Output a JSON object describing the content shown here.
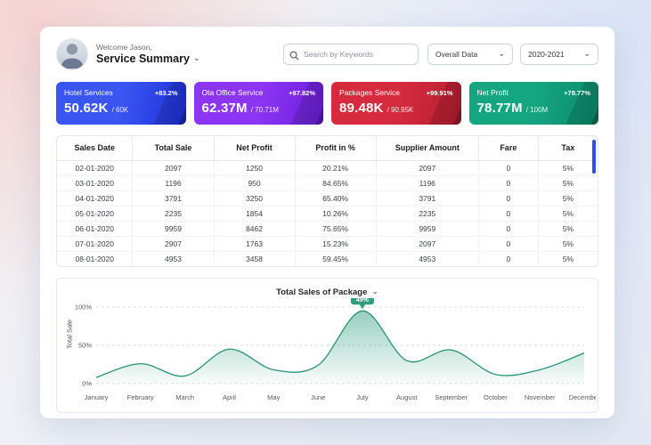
{
  "header": {
    "welcome": "Welcome Jason,",
    "title": "Service Summary",
    "search_placeholder": "Search by Keywords",
    "data_filter_value": "Overall Data",
    "year_filter_value": "2020-2021"
  },
  "stat_cards": [
    {
      "label": "Hotel Services",
      "badge": "+83.2%",
      "value": "50.62K",
      "target": "/ 60K",
      "color_from": "#3a55f2",
      "color_to": "#1d2fd6"
    },
    {
      "label": "Ota Office Service",
      "badge": "+87.82%",
      "value": "62.37M",
      "target": "/ 70.71M",
      "color_from": "#8d35f5",
      "color_to": "#6a1ed8"
    },
    {
      "label": "Packages Service",
      "badge": "+99.91%",
      "value": "89.48K",
      "target": "/ 90.95K",
      "color_from": "#d62a3e",
      "color_to": "#b51e31"
    },
    {
      "label": "Net Profit",
      "badge": "+78.77%",
      "value": "78.77M",
      "target": "/ 100M",
      "color_from": "#14a581",
      "color_to": "#0b8a6a"
    }
  ],
  "table": {
    "columns": [
      "Sales Date",
      "Total Sale",
      "Net Profit",
      "Profit in %",
      "Supplier Amount",
      "Fare",
      "Tax"
    ],
    "rows": [
      [
        "02-01-2020",
        "2097",
        "1250",
        "20.21%",
        "2097",
        "0",
        "5%"
      ],
      [
        "03-01-2020",
        "1196",
        "950",
        "84.65%",
        "1196",
        "0",
        "5%"
      ],
      [
        "04-01-2020",
        "3791",
        "3250",
        "65.40%",
        "3791",
        "0",
        "5%"
      ],
      [
        "05-01-2020",
        "2235",
        "1854",
        "10.26%",
        "2235",
        "0",
        "5%"
      ],
      [
        "06-01-2020",
        "9959",
        "8462",
        "75.65%",
        "9959",
        "0",
        "5%"
      ],
      [
        "07-01-2020",
        "2907",
        "1763",
        "15.23%",
        "2097",
        "0",
        "5%"
      ],
      [
        "08-01-2020",
        "4953",
        "3458",
        "59.45%",
        "4953",
        "0",
        "5%"
      ]
    ]
  },
  "chart_data": {
    "type": "area",
    "title": "Total Sales of Package",
    "ylabel": "Total Sale",
    "yticks": [
      "100%",
      "50%",
      "0%"
    ],
    "ylim": [
      0,
      100
    ],
    "grid": "dashed horizontal",
    "legend": "none",
    "categories": [
      "January",
      "February",
      "March",
      "April",
      "May",
      "June",
      "July",
      "August",
      "September",
      "October",
      "November",
      "December"
    ],
    "values": [
      8,
      26,
      10,
      45,
      18,
      24,
      95,
      30,
      44,
      12,
      18,
      40
    ],
    "peak_label": "49%",
    "peak_index": 6,
    "line_color": "#2a9377",
    "fill_color": "#2e9e7e"
  }
}
